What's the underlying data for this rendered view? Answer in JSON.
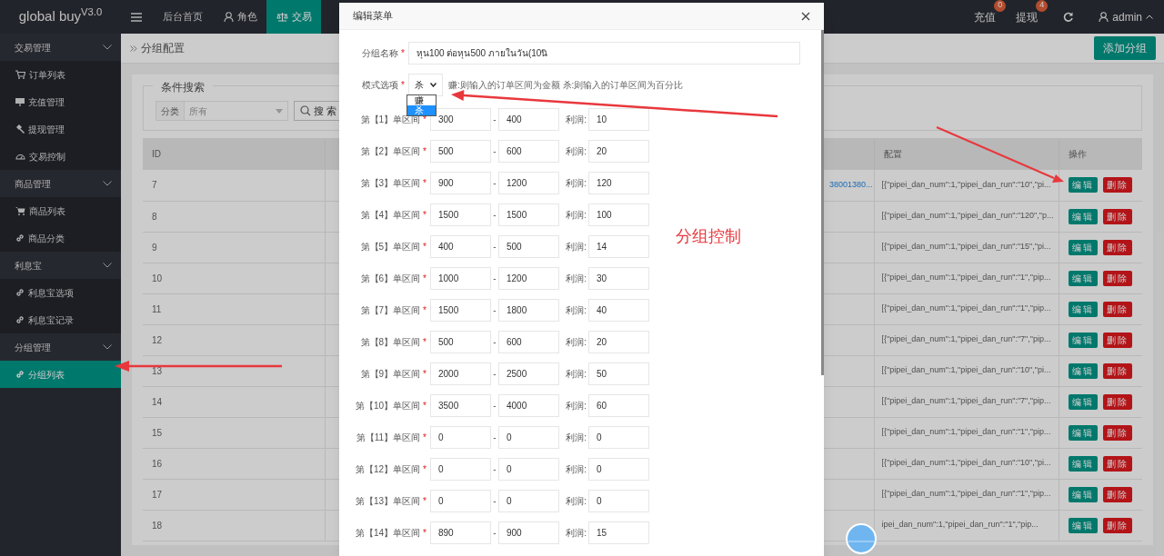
{
  "top_bar": {
    "logo": "global buy$^{V3.0}$",
    "nav": [
      {
        "kind": "menu",
        "selected": false
      },
      {
        "kind": "text",
        "label": "后台首页",
        "selected": false
      },
      {
        "kind": "user",
        "label": "角色",
        "selected": false
      },
      {
        "kind": "scale",
        "label": "交易",
        "selected": true
      }
    ],
    "counters": [
      {
        "label": "充值",
        "badge": "0"
      },
      {
        "label": "提现",
        "badge": "4"
      }
    ],
    "user": "admin"
  },
  "sidebar": {
    "groups": [
      {
        "label": "交易管理",
        "expanded": true,
        "children": [
          {
            "kind": "cart",
            "label": "订单列表",
            "selected": false
          },
          {
            "kind": "board",
            "label": "充值管理",
            "selected": false
          },
          {
            "kind": "hammer",
            "label": "提现管理",
            "selected": false
          },
          {
            "kind": "gauge",
            "label": "交易控制",
            "selected": false
          }
        ]
      },
      {
        "label": "商品管理",
        "expanded": true,
        "children": [
          {
            "kind": "cartfill",
            "label": "商品列表",
            "selected": false
          },
          {
            "kind": "link",
            "label": "商品分类",
            "selected": false
          }
        ]
      },
      {
        "label": "利息宝",
        "expanded": true,
        "children": [
          {
            "kind": "link",
            "label": "利息宝选项",
            "selected": false
          },
          {
            "kind": "link",
            "label": "利息宝记录",
            "selected": false
          }
        ]
      },
      {
        "label": "分组管理",
        "expanded": true,
        "children": [
          {
            "kind": "link",
            "label": "分组列表",
            "selected": true
          }
        ]
      }
    ]
  },
  "content": {
    "breadcrumb": "分组配置",
    "add_button": "添加分组",
    "search": {
      "legend": "条件搜索",
      "label": "分类",
      "placeholder": "所有",
      "button": "搜索"
    },
    "table": {
      "columns": {
        "id": "ID",
        "config": "配置",
        "actions": "操作"
      },
      "rows": [
        {
          "id": "7",
          "column_3": "38001380...",
          "config": "[{\"pipei_dan_num\":1,\"pipei_dan_run\":\"10\",\"pi...",
          "edit": "编辑",
          "delete": "删除"
        },
        {
          "id": "8",
          "config": "[{\"pipei_dan_num\":1,\"pipei_dan_run\":\"120\",\"p...",
          "edit": "编辑",
          "delete": "删除"
        },
        {
          "id": "9",
          "config": "[{\"pipei_dan_num\":1,\"pipei_dan_run\":\"15\",\"pi...",
          "edit": "编辑",
          "delete": "删除"
        },
        {
          "id": "10",
          "config": "[{\"pipei_dan_num\":1,\"pipei_dan_run\":\"1\",\"pip...",
          "edit": "编辑",
          "delete": "删除"
        },
        {
          "id": "11",
          "config": "[{\"pipei_dan_num\":1,\"pipei_dan_run\":\"1\",\"pip...",
          "edit": "编辑",
          "delete": "删除"
        },
        {
          "id": "12",
          "config": "[{\"pipei_dan_num\":1,\"pipei_dan_run\":\"7\",\"pip...",
          "edit": "编辑",
          "delete": "删除"
        },
        {
          "id": "13",
          "config": "[{\"pipei_dan_num\":1,\"pipei_dan_run\":\"10\",\"pi...",
          "edit": "编辑",
          "delete": "删除"
        },
        {
          "id": "14",
          "config": "[{\"pipei_dan_num\":1,\"pipei_dan_run\":\"7\",\"pip...",
          "edit": "编辑",
          "delete": "删除"
        },
        {
          "id": "15",
          "config": "[{\"pipei_dan_num\":1,\"pipei_dan_run\":\"1\",\"pip...",
          "edit": "编辑",
          "delete": "删除"
        },
        {
          "id": "16",
          "config": "[{\"pipei_dan_num\":1,\"pipei_dan_run\":\"10\",\"pi...",
          "edit": "编辑",
          "delete": "删除"
        },
        {
          "id": "17",
          "config": "[{\"pipei_dan_num\":1,\"pipei_dan_run\":\"1\",\"pip...",
          "edit": "编辑",
          "delete": "删除"
        },
        {
          "id": "18",
          "config": "ipei_dan_num\":1,\"pipei_dan_run\":\"1\",\"pip...",
          "edit": "编辑",
          "delete": "删除"
        }
      ]
    }
  },
  "modal": {
    "title": "编辑菜单",
    "name_field": {
      "label": "分组名称",
      "required_mark": "*",
      "value": "หุน100 ต่อหุน500 ภายในวัน(10นิ"
    },
    "mode_field": {
      "label": "模式选项",
      "required_mark": "*",
      "value": "杀",
      "expanded": true,
      "options": [
        {
          "label": "赚",
          "selected": false
        },
        {
          "label": "杀",
          "selected": true
        }
      ],
      "hint": "赚:则输入的订单区间为金额 杀:则输入的订单区间为百分比"
    },
    "intervals": [
      {
        "label": "第【1】单区间",
        "required_mark": "*",
        "from": "300",
        "separator": "-",
        "to": "400",
        "profit_label": "利润:",
        "profit": "10"
      },
      {
        "label": "第【2】单区间",
        "required_mark": "*",
        "from": "500",
        "separator": "-",
        "to": "600",
        "profit_label": "利润:",
        "profit": "20"
      },
      {
        "label": "第【3】单区间",
        "required_mark": "*",
        "from": "900",
        "separator": "-",
        "to": "1200",
        "profit_label": "利润:",
        "profit": "120"
      },
      {
        "label": "第【4】单区间",
        "required_mark": "*",
        "from": "1500",
        "separator": "-",
        "to": "1500",
        "profit_label": "利润:",
        "profit": "100"
      },
      {
        "label": "第【5】单区间",
        "required_mark": "*",
        "from": "400",
        "separator": "-",
        "to": "500",
        "profit_label": "利润:",
        "profit": "14"
      },
      {
        "label": "第【6】单区间",
        "required_mark": "*",
        "from": "1000",
        "separator": "-",
        "to": "1200",
        "profit_label": "利润:",
        "profit": "30"
      },
      {
        "label": "第【7】单区间",
        "required_mark": "*",
        "from": "1500",
        "separator": "-",
        "to": "1800",
        "profit_label": "利润:",
        "profit": "40"
      },
      {
        "label": "第【8】单区间",
        "required_mark": "*",
        "from": "500",
        "separator": "-",
        "to": "600",
        "profit_label": "利润:",
        "profit": "20"
      },
      {
        "label": "第【9】单区间",
        "required_mark": "*",
        "from": "2000",
        "separator": "-",
        "to": "2500",
        "profit_label": "利润:",
        "profit": "50"
      },
      {
        "label": "第【10】单区间",
        "required_mark": "*",
        "from": "3500",
        "separator": "-",
        "to": "4000",
        "profit_label": "利润:",
        "profit": "60"
      },
      {
        "label": "第【11】单区间",
        "required_mark": "*",
        "from": "0",
        "separator": "-",
        "to": "0",
        "profit_label": "利润:",
        "profit": "0"
      },
      {
        "label": "第【12】单区间",
        "required_mark": "*",
        "from": "0",
        "separator": "-",
        "to": "0",
        "profit_label": "利润:",
        "profit": "0"
      },
      {
        "label": "第【13】单区间",
        "required_mark": "*",
        "from": "0",
        "separator": "-",
        "to": "0",
        "profit_label": "利润:",
        "profit": "0"
      },
      {
        "label": "第【14】单区间",
        "required_mark": "*",
        "from": "890",
        "separator": "-",
        "to": "900",
        "profit_label": "利润:",
        "profit": "15"
      }
    ]
  },
  "annotation": {
    "text": "分组控制"
  }
}
